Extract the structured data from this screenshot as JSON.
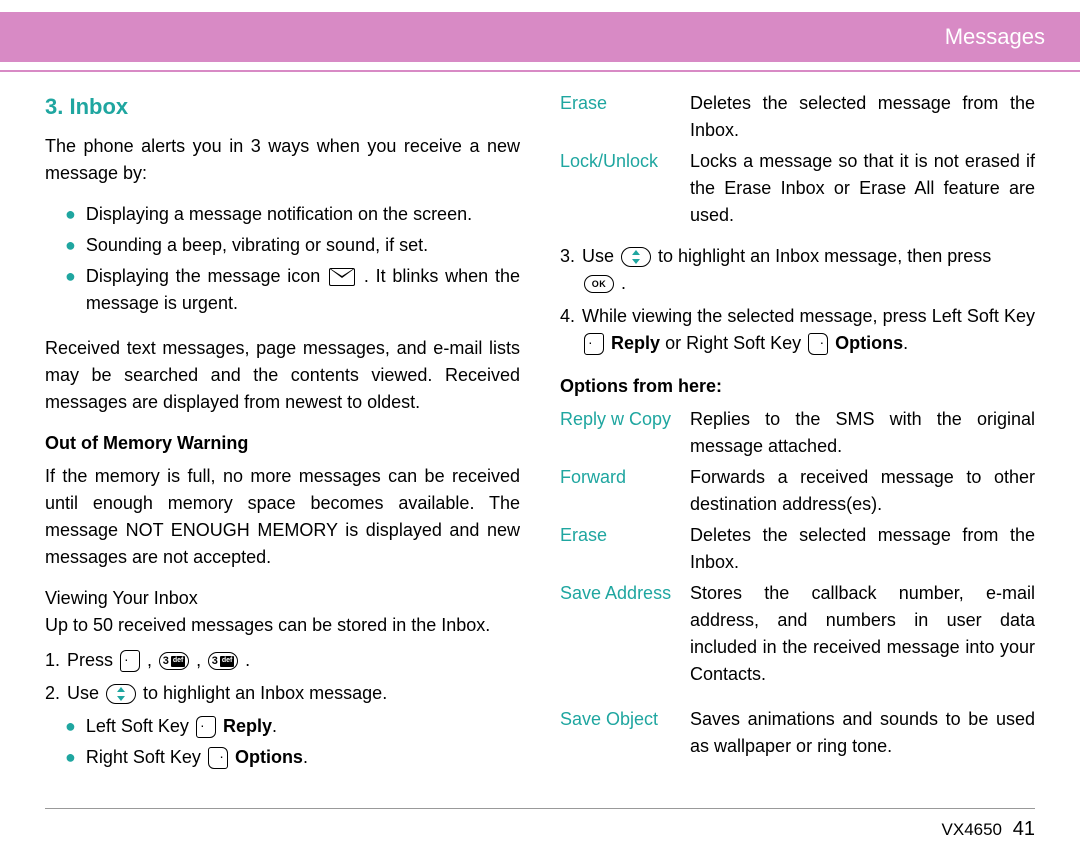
{
  "header": {
    "title": "Messages"
  },
  "left": {
    "section_title": "3. Inbox",
    "intro": "The phone alerts you in 3 ways when you receive a new message by:",
    "bullets": [
      "Displaying a message notification on the screen.",
      "Sounding a beep, vibrating or sound, if set."
    ],
    "bullet3_a": "Displaying the message icon ",
    "bullet3_b": ". It blinks when the message is urgent.",
    "para2": "Received text messages, page messages, and e-mail lists may be searched and the contents viewed. Received messages are displayed from newest to oldest.",
    "subhead1": "Out of Memory Warning",
    "para3": "If the memory is full, no more messages can be received until enough memory space becomes available. The message NOT ENOUGH MEMORY is displayed and new messages are not accepted.",
    "viewing_label": "Viewing Your Inbox",
    "viewing_note": "Up to 50 received messages can be stored in the Inbox.",
    "step1_a": "Press ",
    "step1_b": " ,  ",
    "step1_c": " ,  ",
    "step1_d": " .",
    "step2_a": "Use  ",
    "step2_b": "  to highlight an Inbox message.",
    "sub_bullet1_a": "Left Soft Key ",
    "sub_bullet1_b": "Reply",
    "sub_bullet2_a": "Right Soft Key  ",
    "sub_bullet2_b": "Options"
  },
  "right": {
    "opts1": [
      {
        "label": "Erase",
        "desc": "Deletes the selected message from the Inbox."
      },
      {
        "label": "Lock/Unlock",
        "desc": "Locks a message so that it is not erased if the Erase Inbox or Erase All feature are used."
      }
    ],
    "step3_a": "Use  ",
    "step3_b": "  to highlight an Inbox message, then press ",
    "step3_c": " .",
    "step4_a": "While viewing the selected message, press Left Soft Key ",
    "step4_b": "Reply",
    "step4_c": " or Right Soft Key ",
    "step4_d": "Options",
    "subhead2": "Options from here:",
    "opts2": [
      {
        "label": "Reply w Copy",
        "desc": "Replies to the SMS with the original message attached."
      },
      {
        "label": "Forward",
        "desc": "Forwards a received message to other destination address(es)."
      },
      {
        "label": "Erase",
        "desc": "Deletes the selected message from the Inbox."
      },
      {
        "label": "Save Address",
        "desc": "Stores the callback number, e-mail address, and numbers in user data included in the received message into your Contacts."
      },
      {
        "label": "Save Object",
        "desc": "Saves animations and sounds to be used as wallpaper or ring tone."
      }
    ]
  },
  "footer": {
    "model": "VX4650",
    "page": "41"
  }
}
